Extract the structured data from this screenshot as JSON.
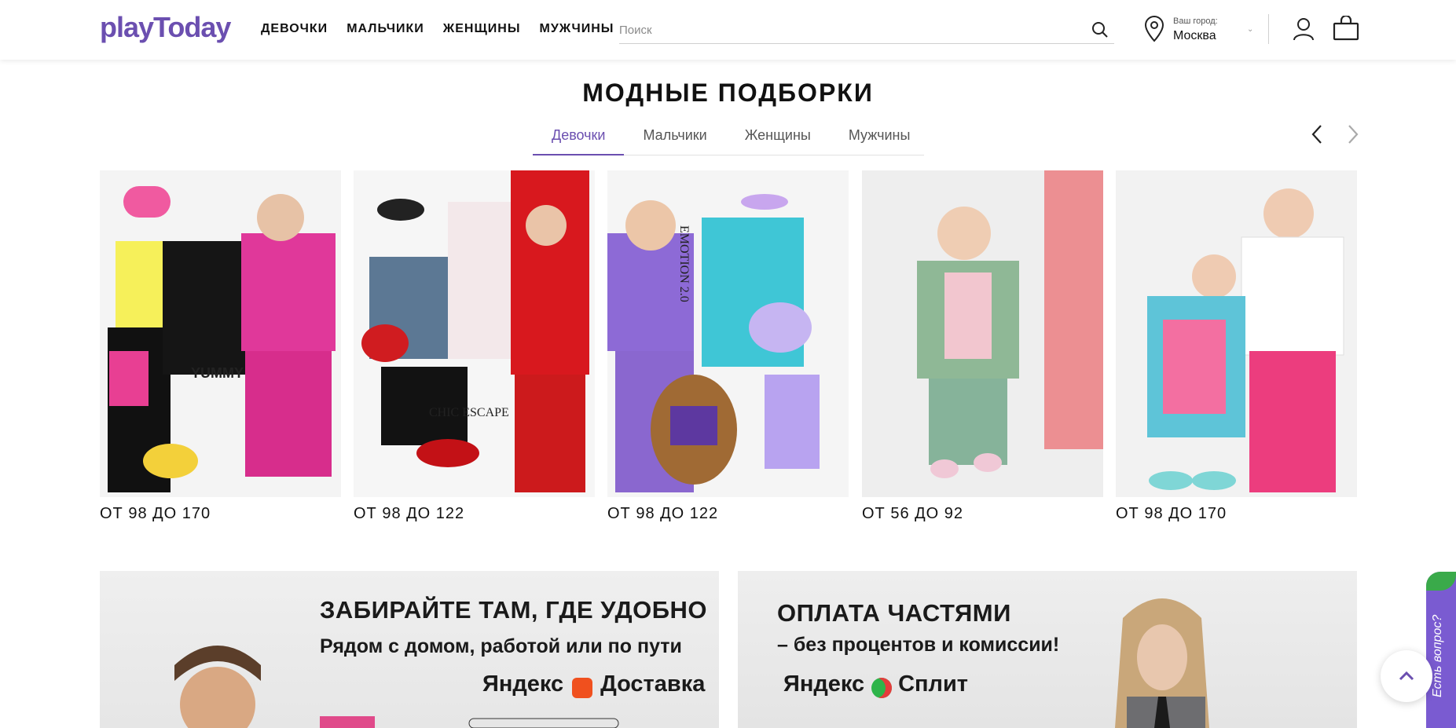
{
  "header": {
    "logo_text": "playToday",
    "nav": [
      "ДЕВОЧКИ",
      "МАЛЬЧИКИ",
      "ЖЕНЩИНЫ",
      "МУЖЧИНЫ"
    ],
    "search_placeholder": "Поиск",
    "city_label": "Ваш город:",
    "city_name": "Москва"
  },
  "section": {
    "title": "МОДНЫЕ ПОДБОРКИ",
    "tabs": [
      "Девочки",
      "Мальчики",
      "Женщины",
      "Мужчины"
    ],
    "active_tab": "Девочки"
  },
  "cards": [
    {
      "caption": "ОТ 98 ДО 170",
      "brand": "YUMMY"
    },
    {
      "caption": "ОТ 98 ДО 122",
      "brand": "CHIC ESCAPE"
    },
    {
      "caption": "ОТ 98 ДО 122",
      "brand": "EMOTION 2.0"
    },
    {
      "caption": "ОТ 56 ДО 92",
      "brand": ""
    },
    {
      "caption": "ОТ 98 ДО 170",
      "brand": ""
    }
  ],
  "banners": {
    "left": {
      "title": "ЗАБИРАЙТЕ ТАМ, ГДЕ УДОБНО",
      "subtitle": "Рядом с домом, работой или по пути",
      "brand_a": "Яндекс",
      "brand_b": "Доставка"
    },
    "right": {
      "title": "ОПЛАТА ЧАСТЯМИ",
      "subtitle": "– без процентов и комиссии!",
      "brand_a": "Яндекс",
      "brand_b": "Сплит"
    }
  },
  "widget": {
    "question_label": "Есть вопрос?"
  },
  "colors": {
    "brand_purple": "#6b4fb0",
    "widget_purple": "#7a5bd1"
  }
}
